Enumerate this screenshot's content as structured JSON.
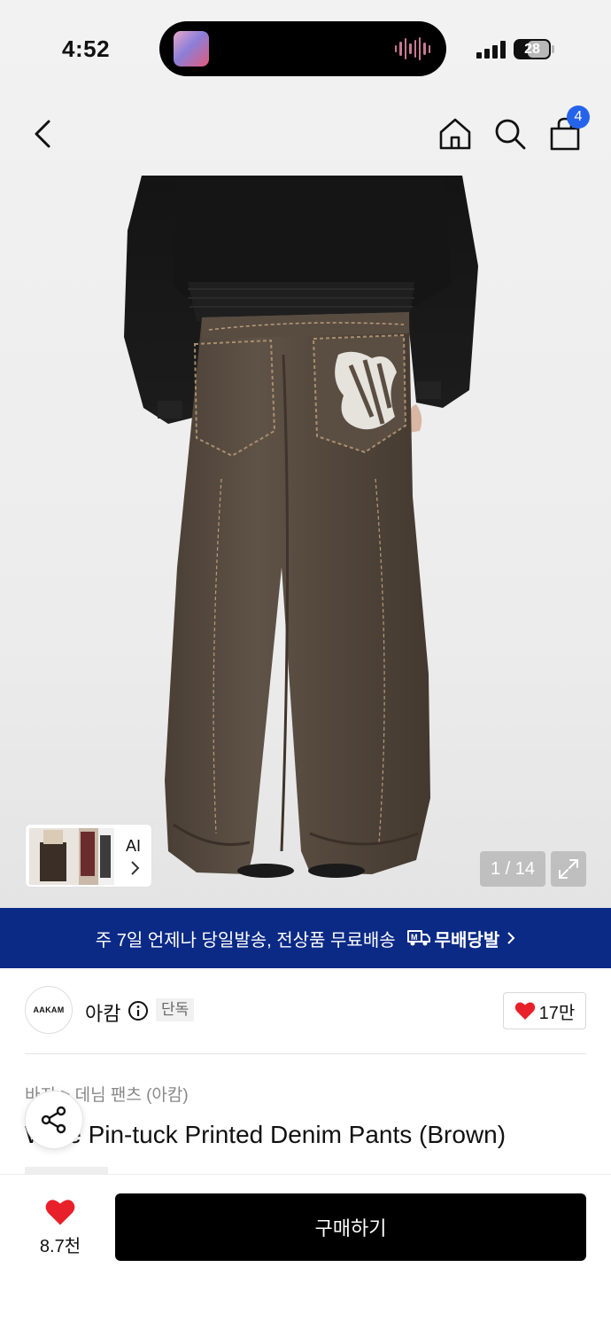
{
  "status_bar": {
    "time": "4:52",
    "battery": "28"
  },
  "nav": {
    "cart_count": "4"
  },
  "gallery": {
    "counter": "1 / 14",
    "ai_label": "AI"
  },
  "banner": {
    "text": "주 7일 언제나 당일발송, 전상품 무료배송",
    "brand": "무배당발"
  },
  "brand": {
    "logo_text": "AAKAM",
    "name": "아캄",
    "exclusive_tag": "단독",
    "likes": "17만"
  },
  "product": {
    "breadcrumb": "바지 > 데님 팬츠 (아캄)",
    "title": "Wide Pin-tuck Printed Denim Pants (Brown)"
  },
  "bottom": {
    "wish_count": "8.7천",
    "buy_label": "구매하기"
  },
  "colors": {
    "banner_bg": "#0b2a86",
    "badge": "#2563eb",
    "heart": "#e8202a",
    "buy_bg": "#000000"
  },
  "icons": [
    "back-arrow-icon",
    "home-icon",
    "search-icon",
    "bag-icon",
    "expand-icon",
    "chevron-right-icon",
    "truck-icon",
    "info-icon",
    "heart-icon",
    "share-icon"
  ]
}
